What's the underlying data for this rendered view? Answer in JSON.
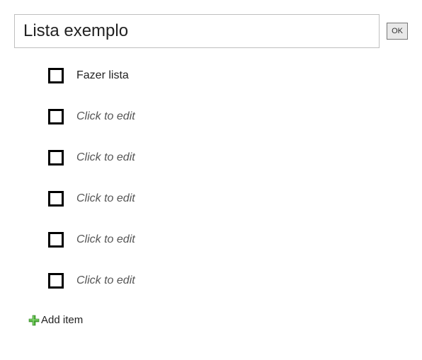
{
  "header": {
    "title_value": "Lista exemplo",
    "ok_label": "OK"
  },
  "items": [
    {
      "label": "Fazer lista",
      "placeholder": false
    },
    {
      "label": "Click to edit",
      "placeholder": true
    },
    {
      "label": "Click to edit",
      "placeholder": true
    },
    {
      "label": "Click to edit",
      "placeholder": true
    },
    {
      "label": "Click to edit",
      "placeholder": true
    },
    {
      "label": "Click to edit",
      "placeholder": true
    }
  ],
  "add_item": {
    "label": "Add item"
  }
}
